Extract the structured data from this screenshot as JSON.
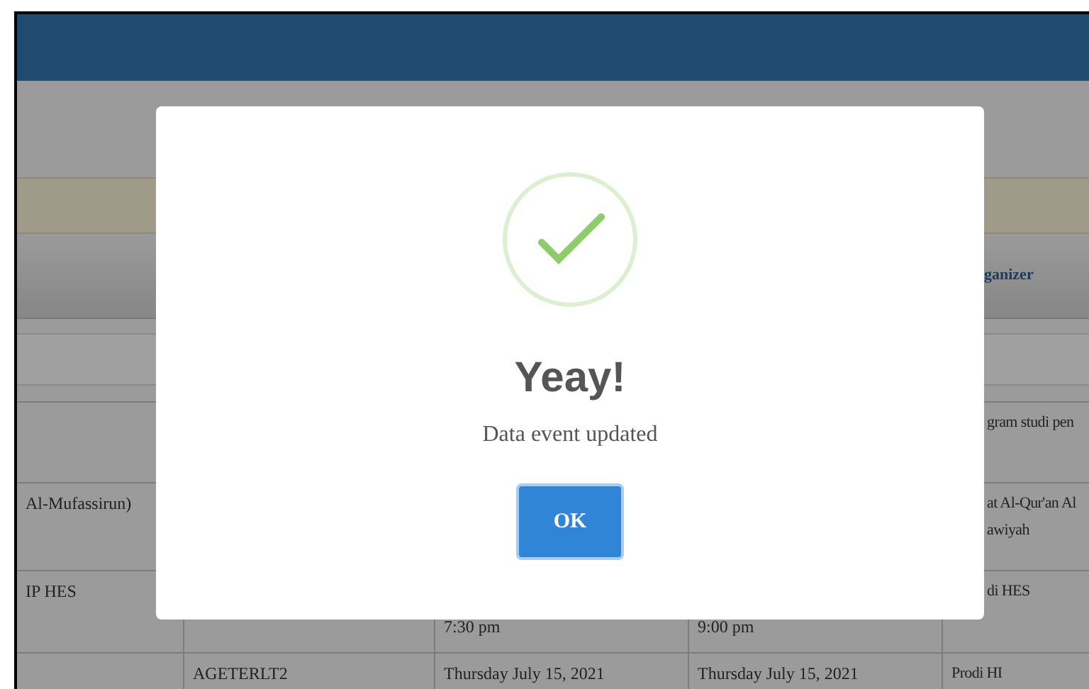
{
  "table": {
    "column_5_header": "ganizer",
    "rows": [
      {
        "column_5": [
          "gram studi pen"
        ]
      },
      {
        "column_1": [
          "Al-Mufassirun)"
        ],
        "column_5": [
          "at Al-Qur'an Al",
          "awiyah"
        ]
      },
      {
        "column_1": [
          "IP HES"
        ],
        "column_3": [
          "7:30 pm"
        ],
        "column_4": [
          "9:00 pm"
        ],
        "column_5": [
          "di HES"
        ]
      },
      {
        "column_2": [
          "AGETERLT2"
        ],
        "column_3": [
          "Thursday July 15, 2021"
        ],
        "column_4": [
          "Thursday July 15, 2021"
        ],
        "column_5": [
          "Prodi HI"
        ]
      }
    ]
  },
  "dialog": {
    "title": "Yeay!",
    "message": "Data event updated",
    "button": "OK"
  }
}
